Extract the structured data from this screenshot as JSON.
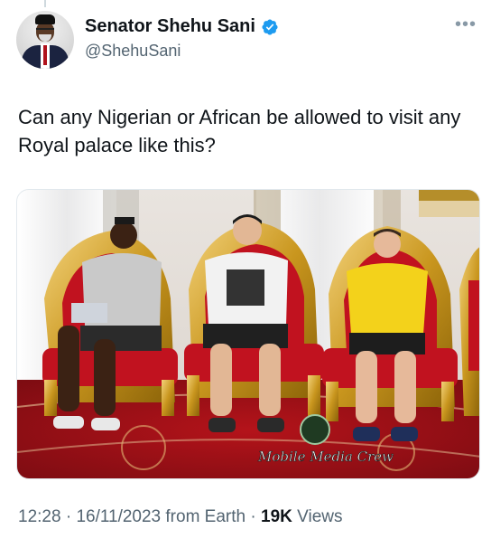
{
  "author": {
    "name": "Senator Shehu Sani",
    "handle": "@ShehuSani",
    "verified": true,
    "avatar_icon": "profile-photo"
  },
  "menu_icon": "more-options-icon",
  "tweet": {
    "text": "Can any Nigerian or African be allowed to visit any Royal palace like this?"
  },
  "media": {
    "watermark": "Mobile Media Crew"
  },
  "meta": {
    "time": "12:28",
    "date": "16/11/2023",
    "source": "from Earth",
    "views_count": "19K",
    "views_label": "Views"
  },
  "colors": {
    "verified_blue": "#1d9bf0",
    "text_primary": "#0f1419",
    "text_secondary": "#536471"
  }
}
